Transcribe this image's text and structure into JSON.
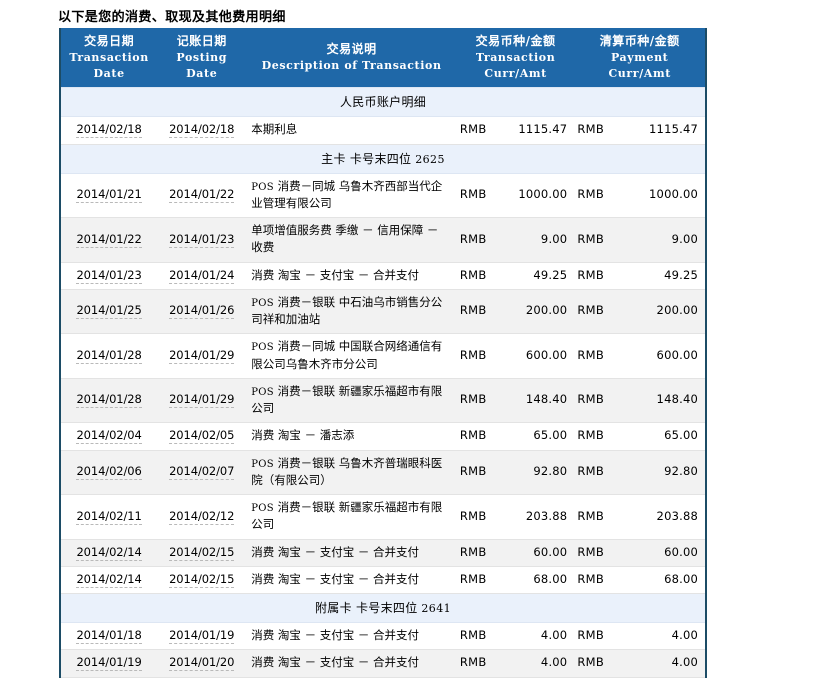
{
  "page": {
    "title": "以下是您的消费、取现及其他费用明细"
  },
  "table": {
    "columns": [
      {
        "cn": "交易日期",
        "en_line1": "Transaction",
        "en_line2": "Date",
        "key": "transaction_date"
      },
      {
        "cn": "记账日期",
        "en_line1": "Posting",
        "en_line2": "Date",
        "key": "posting_date"
      },
      {
        "cn": "交易说明",
        "en_line1": "Description of Transaction",
        "en_line2": "",
        "key": "description"
      },
      {
        "cn": "交易币种/金额",
        "en_line1": "Transaction",
        "en_line2": "Curr/Amt",
        "key": "transaction_curr_amt"
      },
      {
        "cn": "清算币种/金额",
        "en_line1": "Payment",
        "en_line2": "Curr/Amt",
        "key": "payment_curr_amt"
      }
    ],
    "rows": [
      {
        "type": "section",
        "label": "人民币账户明细",
        "number": ""
      },
      {
        "type": "data",
        "shade": "plain",
        "transaction_date": "2014/02/18",
        "posting_date": "2014/02/18",
        "description": "本期利息",
        "pos_tag": "",
        "transaction_curr": "RMB",
        "transaction_amt": "1115.47",
        "payment_curr": "RMB",
        "payment_amt": "1115.47"
      },
      {
        "type": "section",
        "label": "主卡 卡号末四位",
        "number": "2625"
      },
      {
        "type": "data",
        "shade": "plain",
        "transaction_date": "2014/01/21",
        "posting_date": "2014/01/22",
        "description": "消费－同城 乌鲁木齐西部当代企业管理有限公司",
        "pos_tag": "POS",
        "transaction_curr": "RMB",
        "transaction_amt": "1000.00",
        "payment_curr": "RMB",
        "payment_amt": "1000.00"
      },
      {
        "type": "data",
        "shade": "alt",
        "transaction_date": "2014/01/22",
        "posting_date": "2014/01/23",
        "description": "单项增值服务费 季缴 － 信用保障 － 收费",
        "pos_tag": "",
        "transaction_curr": "RMB",
        "transaction_amt": "9.00",
        "payment_curr": "RMB",
        "payment_amt": "9.00"
      },
      {
        "type": "data",
        "shade": "plain",
        "transaction_date": "2014/01/23",
        "posting_date": "2014/01/24",
        "description": "消费 淘宝 － 支付宝 － 合并支付",
        "pos_tag": "",
        "transaction_curr": "RMB",
        "transaction_amt": "49.25",
        "payment_curr": "RMB",
        "payment_amt": "49.25"
      },
      {
        "type": "data",
        "shade": "alt",
        "transaction_date": "2014/01/25",
        "posting_date": "2014/01/26",
        "description": "消费－银联 中石油乌市销售分公司祥和加油站",
        "pos_tag": "POS",
        "transaction_curr": "RMB",
        "transaction_amt": "200.00",
        "payment_curr": "RMB",
        "payment_amt": "200.00"
      },
      {
        "type": "data",
        "shade": "plain",
        "transaction_date": "2014/01/28",
        "posting_date": "2014/01/29",
        "description": "消费－同城 中国联合网络通信有限公司乌鲁木齐市分公司",
        "pos_tag": "POS",
        "transaction_curr": "RMB",
        "transaction_amt": "600.00",
        "payment_curr": "RMB",
        "payment_amt": "600.00"
      },
      {
        "type": "data",
        "shade": "alt",
        "transaction_date": "2014/01/28",
        "posting_date": "2014/01/29",
        "description": "消费－银联 新疆家乐福超市有限公司",
        "pos_tag": "POS",
        "transaction_curr": "RMB",
        "transaction_amt": "148.40",
        "payment_curr": "RMB",
        "payment_amt": "148.40"
      },
      {
        "type": "data",
        "shade": "plain",
        "transaction_date": "2014/02/04",
        "posting_date": "2014/02/05",
        "description": "消费 淘宝 － 潘志添",
        "pos_tag": "",
        "transaction_curr": "RMB",
        "transaction_amt": "65.00",
        "payment_curr": "RMB",
        "payment_amt": "65.00"
      },
      {
        "type": "data",
        "shade": "alt",
        "transaction_date": "2014/02/06",
        "posting_date": "2014/02/07",
        "description": "消费－银联 乌鲁木齐普瑞眼科医院（有限公司）",
        "pos_tag": "POS",
        "transaction_curr": "RMB",
        "transaction_amt": "92.80",
        "payment_curr": "RMB",
        "payment_amt": "92.80"
      },
      {
        "type": "data",
        "shade": "plain",
        "transaction_date": "2014/02/11",
        "posting_date": "2014/02/12",
        "description": "消费－银联 新疆家乐福超市有限公司",
        "pos_tag": "POS",
        "transaction_curr": "RMB",
        "transaction_amt": "203.88",
        "payment_curr": "RMB",
        "payment_amt": "203.88"
      },
      {
        "type": "data",
        "shade": "alt",
        "transaction_date": "2014/02/14",
        "posting_date": "2014/02/15",
        "description": "消费 淘宝 － 支付宝 － 合并支付",
        "pos_tag": "",
        "transaction_curr": "RMB",
        "transaction_amt": "60.00",
        "payment_curr": "RMB",
        "payment_amt": "60.00"
      },
      {
        "type": "data",
        "shade": "plain",
        "transaction_date": "2014/02/14",
        "posting_date": "2014/02/15",
        "description": "消费 淘宝 － 支付宝 － 合并支付",
        "pos_tag": "",
        "transaction_curr": "RMB",
        "transaction_amt": "68.00",
        "payment_curr": "RMB",
        "payment_amt": "68.00"
      },
      {
        "type": "section",
        "label": "附属卡 卡号末四位",
        "number": "2641"
      },
      {
        "type": "data",
        "shade": "plain",
        "transaction_date": "2014/01/18",
        "posting_date": "2014/01/19",
        "description": "消费 淘宝 － 支付宝 － 合并支付",
        "pos_tag": "",
        "transaction_curr": "RMB",
        "transaction_amt": "4.00",
        "payment_curr": "RMB",
        "payment_amt": "4.00"
      },
      {
        "type": "data",
        "shade": "alt",
        "transaction_date": "2014/01/19",
        "posting_date": "2014/01/20",
        "description": "消费 淘宝 － 支付宝 － 合并支付",
        "pos_tag": "",
        "transaction_curr": "RMB",
        "transaction_amt": "4.00",
        "payment_curr": "RMB",
        "payment_amt": "4.00"
      }
    ]
  },
  "colors": {
    "header_background": "#1f68a8",
    "header_text": "#ffffff",
    "section_row_background": "#eaf1fb",
    "alt_row_background": "#f2f2f2",
    "table_border": "#1c4c66"
  }
}
